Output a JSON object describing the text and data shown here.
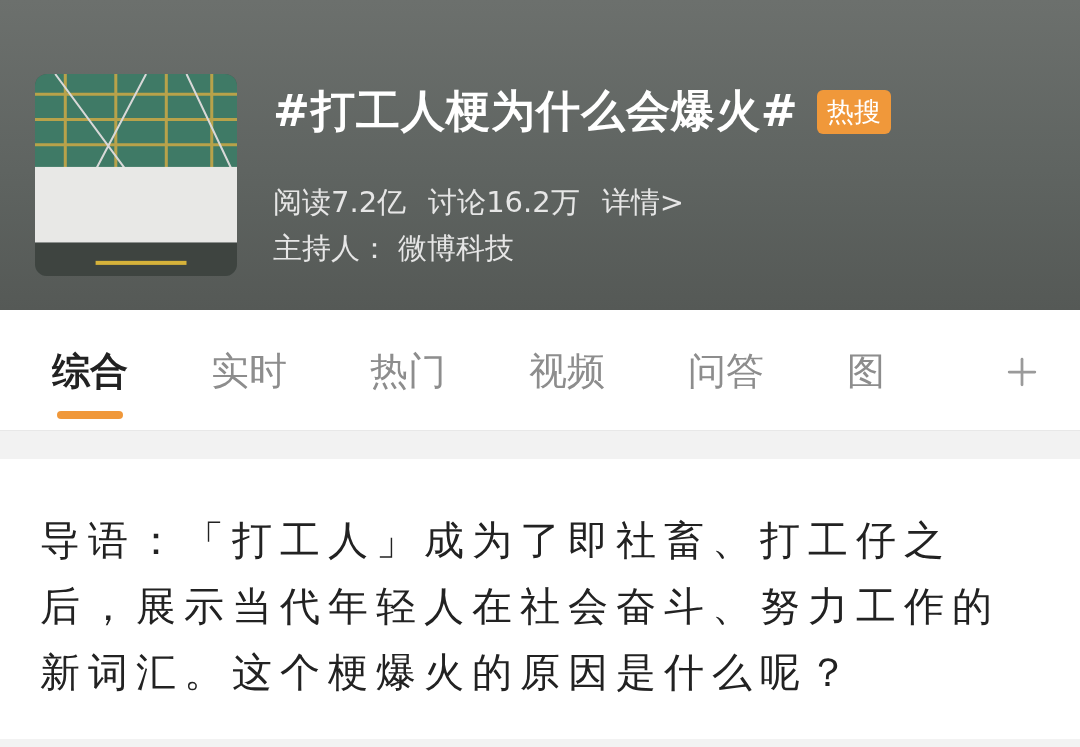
{
  "header": {
    "title": "#打工人梗为什么会爆火#",
    "badge": "热搜",
    "stats": [
      "阅读7.2亿",
      "讨论16.2万"
    ],
    "details_link": "详情>",
    "host": "主持人： 微博科技"
  },
  "tabs": [
    {
      "label": "综合",
      "selected": true
    },
    {
      "label": "实时",
      "selected": false
    },
    {
      "label": "热门",
      "selected": false
    },
    {
      "label": "视频",
      "selected": false
    },
    {
      "label": "问答",
      "selected": false
    },
    {
      "label": "图",
      "selected": false
    }
  ],
  "intro": "导语：「打工人」成为了即社畜、打工仔之后，展示当代年轻人在社会奋斗、努力工作的新词汇。这个梗爆火的原因是什么呢？"
}
